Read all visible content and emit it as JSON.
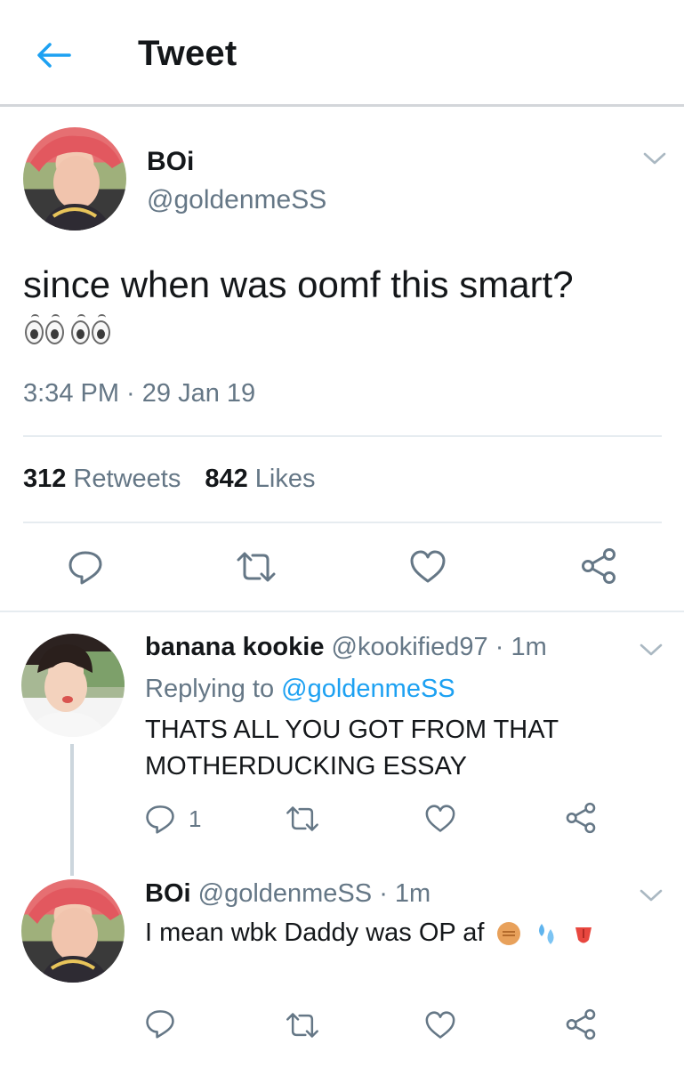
{
  "header": {
    "title": "Tweet",
    "back_icon": "arrow-left-icon",
    "accent": "#1da1f2"
  },
  "tweet": {
    "author_name": "BOi",
    "author_handle": "@goldenmeSS",
    "text": "since when was oomf this smart?",
    "emojis": [
      "eyes-emoji",
      "eyes-emoji"
    ],
    "timestamp": "3:34 PM · 29 Jan 19",
    "retweets_count": "312",
    "retweets_label": "Retweets",
    "likes_count": "842",
    "likes_label": "Likes"
  },
  "replies": [
    {
      "name": "banana kookie",
      "handle": "@kookified97",
      "time": "· 1m",
      "replying_prefix": "Replying to",
      "replying_handle": "@goldenmeSS",
      "line1": "THATS ALL YOU GOT FROM THAT",
      "line2": "MOTHERDUCKING ESSAY",
      "reply_count": "1"
    },
    {
      "name": "BOi",
      "handle": "@goldenmeSS",
      "time": "· 1m",
      "text": "I mean wbk Daddy was OP af",
      "emojis": [
        "raised-fist-emoji",
        "sweat-droplets-emoji",
        "tongue-emoji"
      ]
    }
  ],
  "colors": {
    "text": "#14171a",
    "secondary": "#657786",
    "icon": "#657786",
    "divider": "#e6ecf0"
  }
}
